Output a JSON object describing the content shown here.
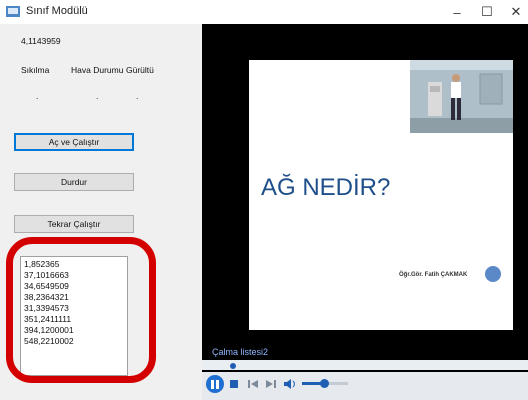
{
  "window": {
    "title": "Sınıf Modülü",
    "minimize": "–",
    "maximize": "☐",
    "close": "✕"
  },
  "left": {
    "value": "4,1143959",
    "headers": [
      "Sıkılma",
      "Hava Durumu",
      "Gürültü"
    ],
    "dots": [
      ".",
      ".",
      "."
    ],
    "buttons": {
      "open_run": "Aç ve Çalıştır",
      "stop": "Durdur",
      "rerun": "Tekrar Çalıştır"
    },
    "list": [
      "1,852365",
      "37,1016663",
      "34,6549509",
      "38,2364321",
      "31,3394573",
      "351,2411111",
      "394,1200001",
      "548,2210002"
    ]
  },
  "player": {
    "slide_title": "AĞ NEDİR?",
    "slide_author": "Öğr.Gör. Fatih ÇAKMAK",
    "playlist_label": "Çalma listesi2"
  },
  "colors": {
    "annotation": "#d40000",
    "slide_title": "#1f4f8b",
    "accent": "#1e6fd1"
  }
}
